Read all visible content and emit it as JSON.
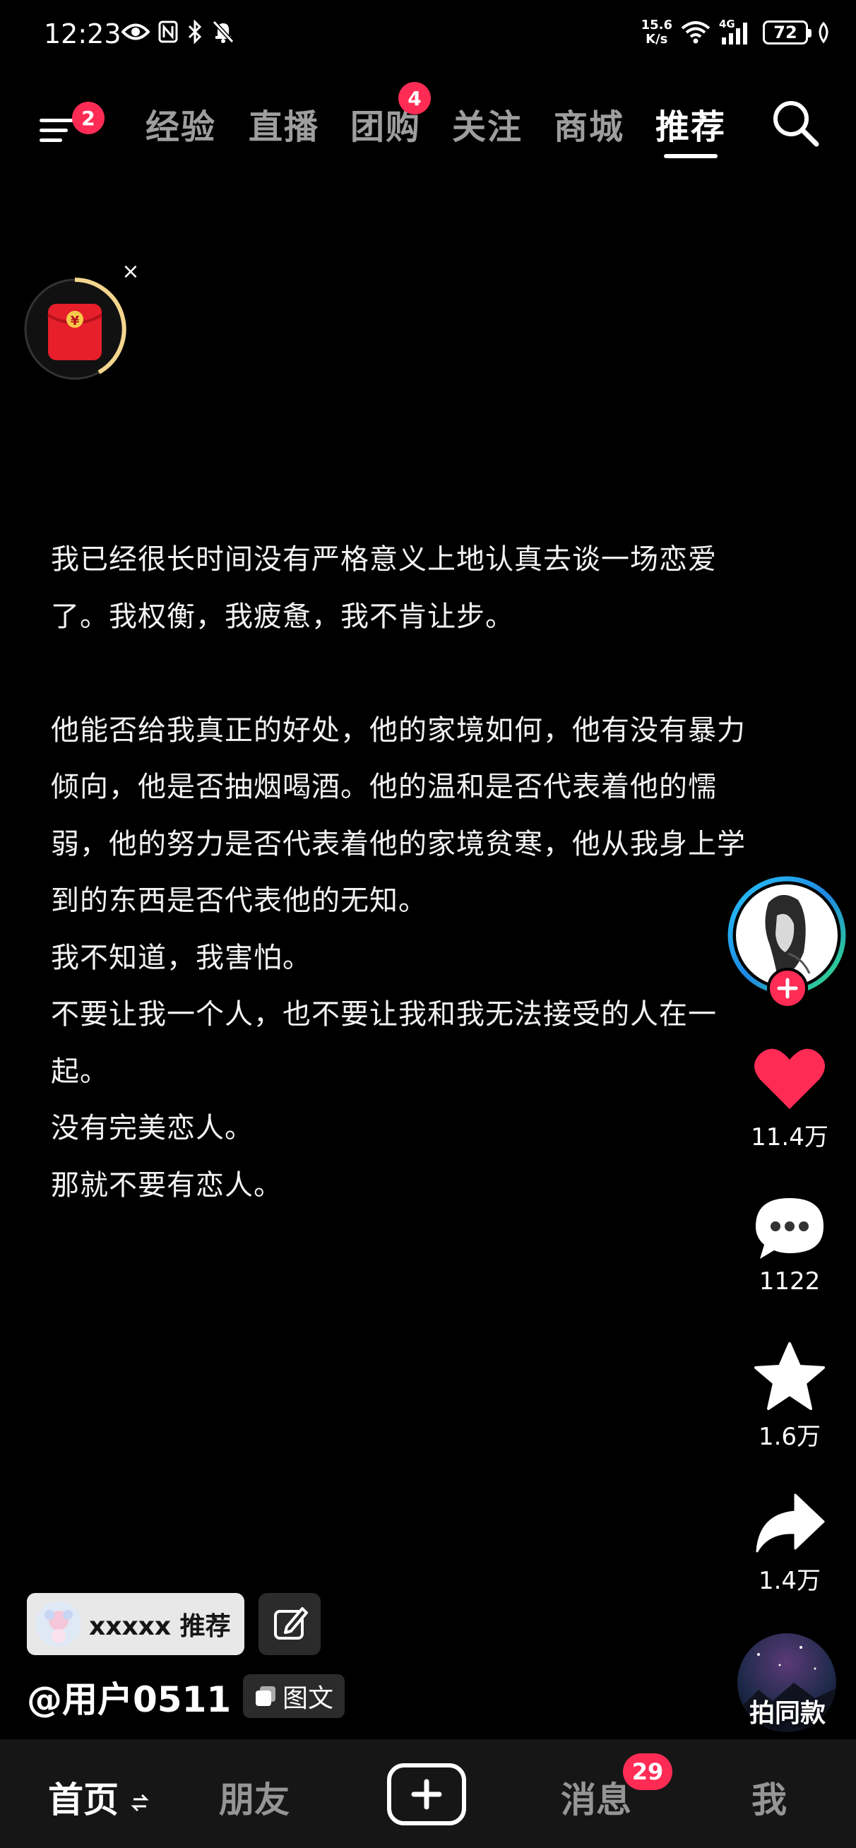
{
  "status_bar": {
    "time": "12:23",
    "net_speed_value": "15.6",
    "net_speed_unit": "K/s",
    "network": "4G",
    "battery": "72"
  },
  "top_nav": {
    "menu_badge": "2",
    "tabs": [
      {
        "label": "经验"
      },
      {
        "label": "直播"
      },
      {
        "label": "团购",
        "badge": "4"
      },
      {
        "label": "关注"
      },
      {
        "label": "商城"
      },
      {
        "label": "推荐",
        "active": true
      }
    ]
  },
  "red_packet": {
    "close": "×",
    "symbol": "¥"
  },
  "post": {
    "lines": [
      "我已经很长时间没有严格意义上地认真去谈一场恋爱",
      "了。我权衡，我疲惫，我不肯让步。",
      "",
      "他能否给我真正的好处，他的家境如何，他有没有暴力",
      "倾向，他是否抽烟喝酒。他的温和是否代表着他的懦",
      "弱，他的努力是否代表着他的家境贫寒，他从我身上学",
      "到的东西是否代表他的无知。",
      "我不知道，我害怕。",
      "不要让我一个人，也不要让我和我无法接受的人在一",
      "起。",
      "没有完美恋人。",
      "那就不要有恋人。"
    ]
  },
  "actions": {
    "likes": "11.4万",
    "comments": "1122",
    "favorites": "1.6万",
    "shares": "1.4万"
  },
  "bottom_info": {
    "recommend_chip": "xxxxx 推荐",
    "username": "@用户0511",
    "type_tag": "图文",
    "remix_label": "拍同款"
  },
  "bottom_nav": {
    "home": "首页",
    "friends": "朋友",
    "messages": "消息",
    "messages_badge": "29",
    "me": "我"
  },
  "colors": {
    "accent": "#fe2c55",
    "background": "#000000",
    "nav_bar": "#161616"
  }
}
